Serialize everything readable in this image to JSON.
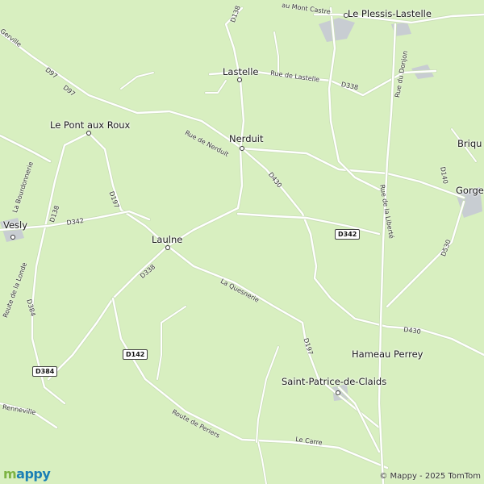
{
  "map": {
    "background_color": "#d8efc0",
    "road_color": "#ffffff",
    "settlement_color": "#c8cdd2"
  },
  "places": {
    "plessis": "Le Plessis-Lastelle",
    "lastelle": "Lastelle",
    "pont_aux_roux": "Le Pont aux Roux",
    "nerduit": "Nerduit",
    "briq": "Briqu",
    "gorges": "Gorges",
    "vesly": "Vesly",
    "laulne": "Laulne",
    "hameau_perrey": "Hameau Perrey",
    "saint_patrice": "Saint-Patrice-de-Claids"
  },
  "streets": {
    "mont_castre": "au Mont Castre",
    "gerville": "Gerville",
    "d97_a": "D97",
    "d97_b": "D97",
    "d138_top": "D138",
    "rue_lastelle": "Rue de Lastelle",
    "d338_top": "D338",
    "rue_du_donjon": "Rue du Donjon",
    "rue_de_nerduit": "Rue de Nerduit",
    "bourdonnerie": "La Bourdonnerie",
    "d140": "D140",
    "d430_a": "D430",
    "rue_liberte": "Rue de la Liberté",
    "d197_a": "D197",
    "d138_left": "D138",
    "d342_left": "D342",
    "route_londe": "Route de la Londe",
    "d338_mid": "D338",
    "quesnerie": "La Quesnerie",
    "d530": "D530",
    "d384": "D384",
    "d430_b": "D430",
    "d197_b": "D197",
    "renneville": "Renneville",
    "route_periers": "Route de Periers",
    "le_carre": "Le Carre"
  },
  "shields": {
    "d342": "D342",
    "d142": "D142",
    "d384": "D384"
  },
  "footer": {
    "logo_prefix": "m",
    "logo_suffix": "appy",
    "copyright": "© Mappy - 2025 TomTom"
  }
}
